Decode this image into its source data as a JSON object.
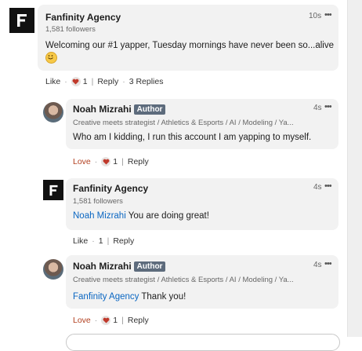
{
  "comments": [
    {
      "author": "Fanfinity Agency",
      "subtitle": "1,581 followers",
      "time": "10s",
      "text": "Welcoming our #1 yapper, Tuesday mornings have never been so...alive",
      "emoji": "smiling-face",
      "actions": {
        "reaction": "Like",
        "count": "1",
        "reply": "Reply",
        "replies": "3 Replies"
      }
    },
    {
      "author": "Noah Mizrahi",
      "badge": "Author",
      "subtitle": "Creative meets strategist / Athletics & Esports / AI / Modeling / Ya...",
      "time": "4s",
      "text": "Who am I kidding, I run this account I am yapping to myself.",
      "actions": {
        "reaction": "Love",
        "count": "1",
        "reply": "Reply"
      }
    },
    {
      "author": "Fanfinity Agency",
      "subtitle": "1,581 followers",
      "time": "4s",
      "mention": "Noah Mizrahi",
      "text": "You are doing great!",
      "actions": {
        "reaction": "Like",
        "count": "1",
        "reply": "Reply"
      }
    },
    {
      "author": "Noah Mizrahi",
      "badge": "Author",
      "subtitle": "Creative meets strategist / Athletics & Esports / AI / Modeling / Ya...",
      "time": "4s",
      "mention": "Fanfinity Agency",
      "text": "Thank you!",
      "actions": {
        "reaction": "Love",
        "count": "1",
        "reply": "Reply"
      }
    }
  ],
  "colors": {
    "link": "#0a66c2",
    "love": "#b24020",
    "heart": "#c0392b",
    "bubble": "#f2f2f2"
  }
}
